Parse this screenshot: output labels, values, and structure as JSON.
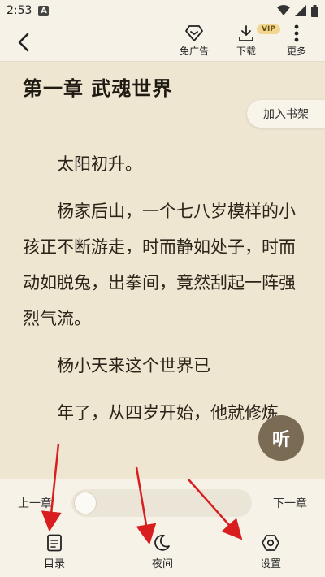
{
  "status_bar": {
    "time": "2:53",
    "notification_letter": "A"
  },
  "toolbar": {
    "back_icon": "back-arrow-icon",
    "ad_free_label": "免广告",
    "download_label": "下载",
    "vip_badge": "VIP",
    "more_label": "更多"
  },
  "reader": {
    "chapter_title": "第一章 武魂世界",
    "add_to_bookshelf": "加入书架",
    "paragraphs": [
      "太阳初升。",
      "杨家后山，一个七八岁模样的小孩正不断游走，时而静如处子，时而动如脱兔，出拳间，竟然刮起一阵强烈气流。",
      "杨小天来这个世界已",
      "年了，从四岁开始，他就修炼"
    ],
    "listen_button": "听"
  },
  "progress": {
    "prev_chapter": "上一章",
    "next_chapter": "下一章",
    "value": 0.0
  },
  "tabs": [
    {
      "label": "目录",
      "icon": "catalog-icon"
    },
    {
      "label": "夜间",
      "icon": "moon-icon"
    },
    {
      "label": "设置",
      "icon": "settings-icon"
    }
  ],
  "colors": {
    "paper": "#efe6d2",
    "panel": "#f7f2e8",
    "listen": "#7a6b55",
    "vip": "#f1d68f",
    "arrow": "#d81e1e"
  }
}
